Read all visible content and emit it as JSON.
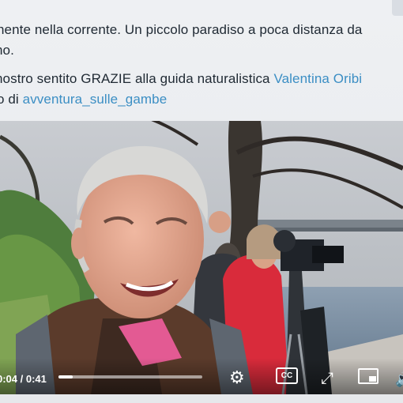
{
  "post": {
    "line1": "nente nella corrente. Un piccolo paradiso a poca distanza da",
    "line2": "no.",
    "line3_prefix": "nostro sentito GRAZIE alla guida naturalistica ",
    "line3_link": "Valentina Oribi",
    "line4_prefix": "o di ",
    "line4_link": "avventura_sulle_gambe"
  },
  "video": {
    "time": "0:04 / 0:41",
    "progress": 0.1,
    "cc_label": "CC"
  },
  "colors": {
    "link": "#3b8ec4",
    "text": "#1f2933",
    "background": "#eceef1"
  },
  "icons": [
    "settings-gear-icon",
    "closed-captions-icon",
    "expand-icon",
    "picture-in-picture-icon",
    "volume-icon"
  ]
}
